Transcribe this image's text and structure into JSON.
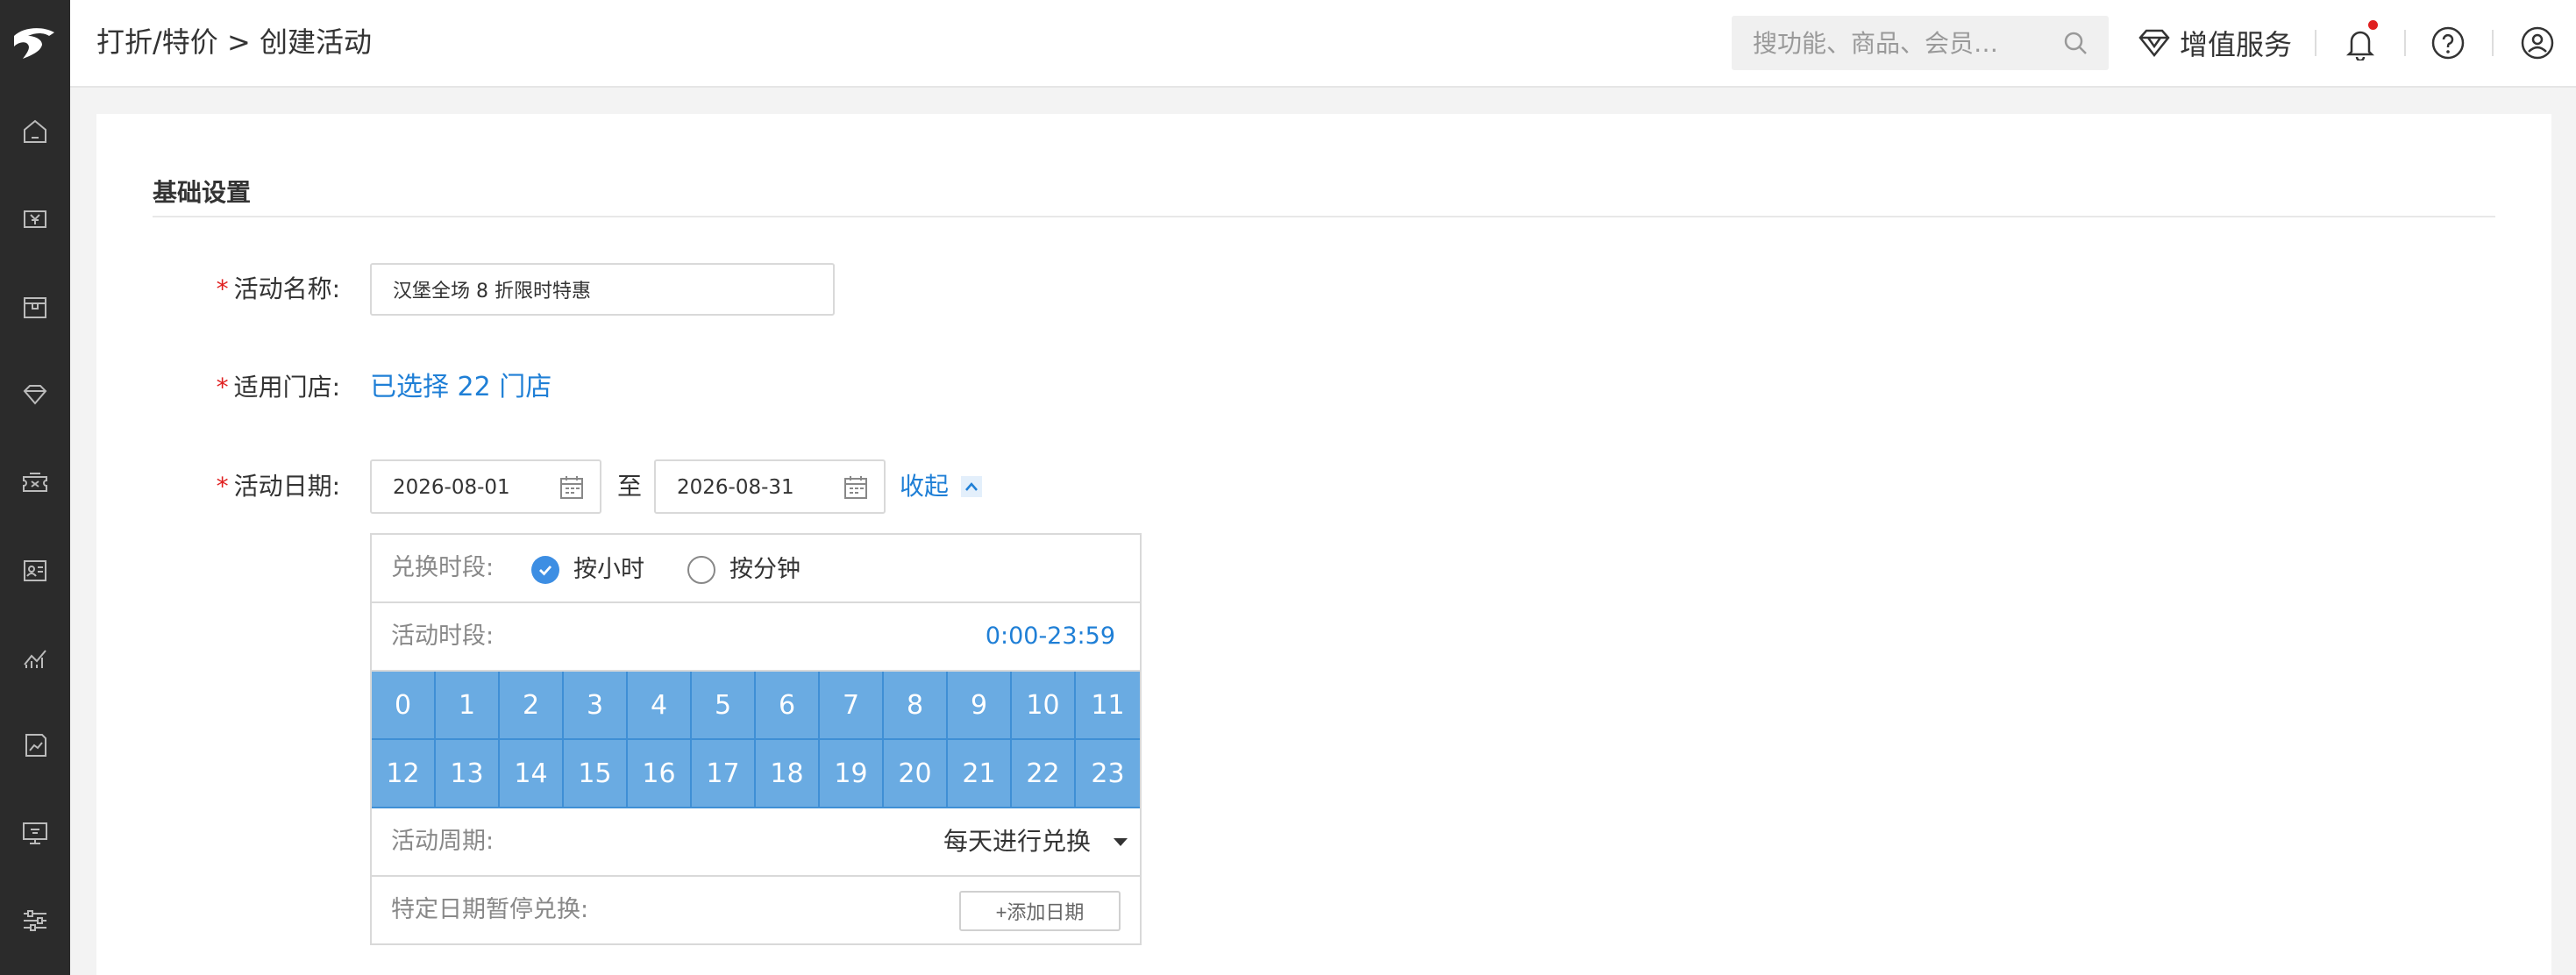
{
  "breadcrumb": "打折/特价 > 创建活动",
  "search": {
    "placeholder": "搜功能、商品、会员…"
  },
  "header": {
    "value_added_label": "增值服务"
  },
  "sidebar": {
    "icons": [
      "home-icon",
      "cashier-icon",
      "goods-box-icon",
      "member-diamond-icon",
      "marketing-coupon-icon",
      "member-card-icon",
      "analytics-chart-icon",
      "report-icon",
      "device-screen-icon",
      "settings-sliders-icon"
    ]
  },
  "form": {
    "section_title": "基础设置",
    "name_label": "活动名称:",
    "name_value": "汉堡全场 8 折限时特惠",
    "store_label": "适用门店:",
    "store_link": "已选择 22 门店",
    "date_label": "活动日期:",
    "start_date": "2026-08-01",
    "end_date": "2026-08-31",
    "to_text": "至",
    "collapse_label": "收起"
  },
  "panel": {
    "exchange_label": "兑换时段:",
    "option_hour": "按小时",
    "option_minute": "按分钟",
    "selected_option": "按小时",
    "period_label": "活动时段:",
    "period_value": "0:00-23:59",
    "hours": [
      "0",
      "1",
      "2",
      "3",
      "4",
      "5",
      "6",
      "7",
      "8",
      "9",
      "10",
      "11",
      "12",
      "13",
      "14",
      "15",
      "16",
      "17",
      "18",
      "19",
      "20",
      "21",
      "22",
      "23"
    ],
    "cycle_label": "活动周期:",
    "cycle_value": "每天进行兑换",
    "pause_label": "特定日期暂停兑换:",
    "add_date_label": "+添加日期"
  },
  "colors": {
    "accent": "#1f7fd6",
    "required": "#e02020",
    "hour_selected": "#6aabe2",
    "sidebar": "#2b2b2b"
  }
}
